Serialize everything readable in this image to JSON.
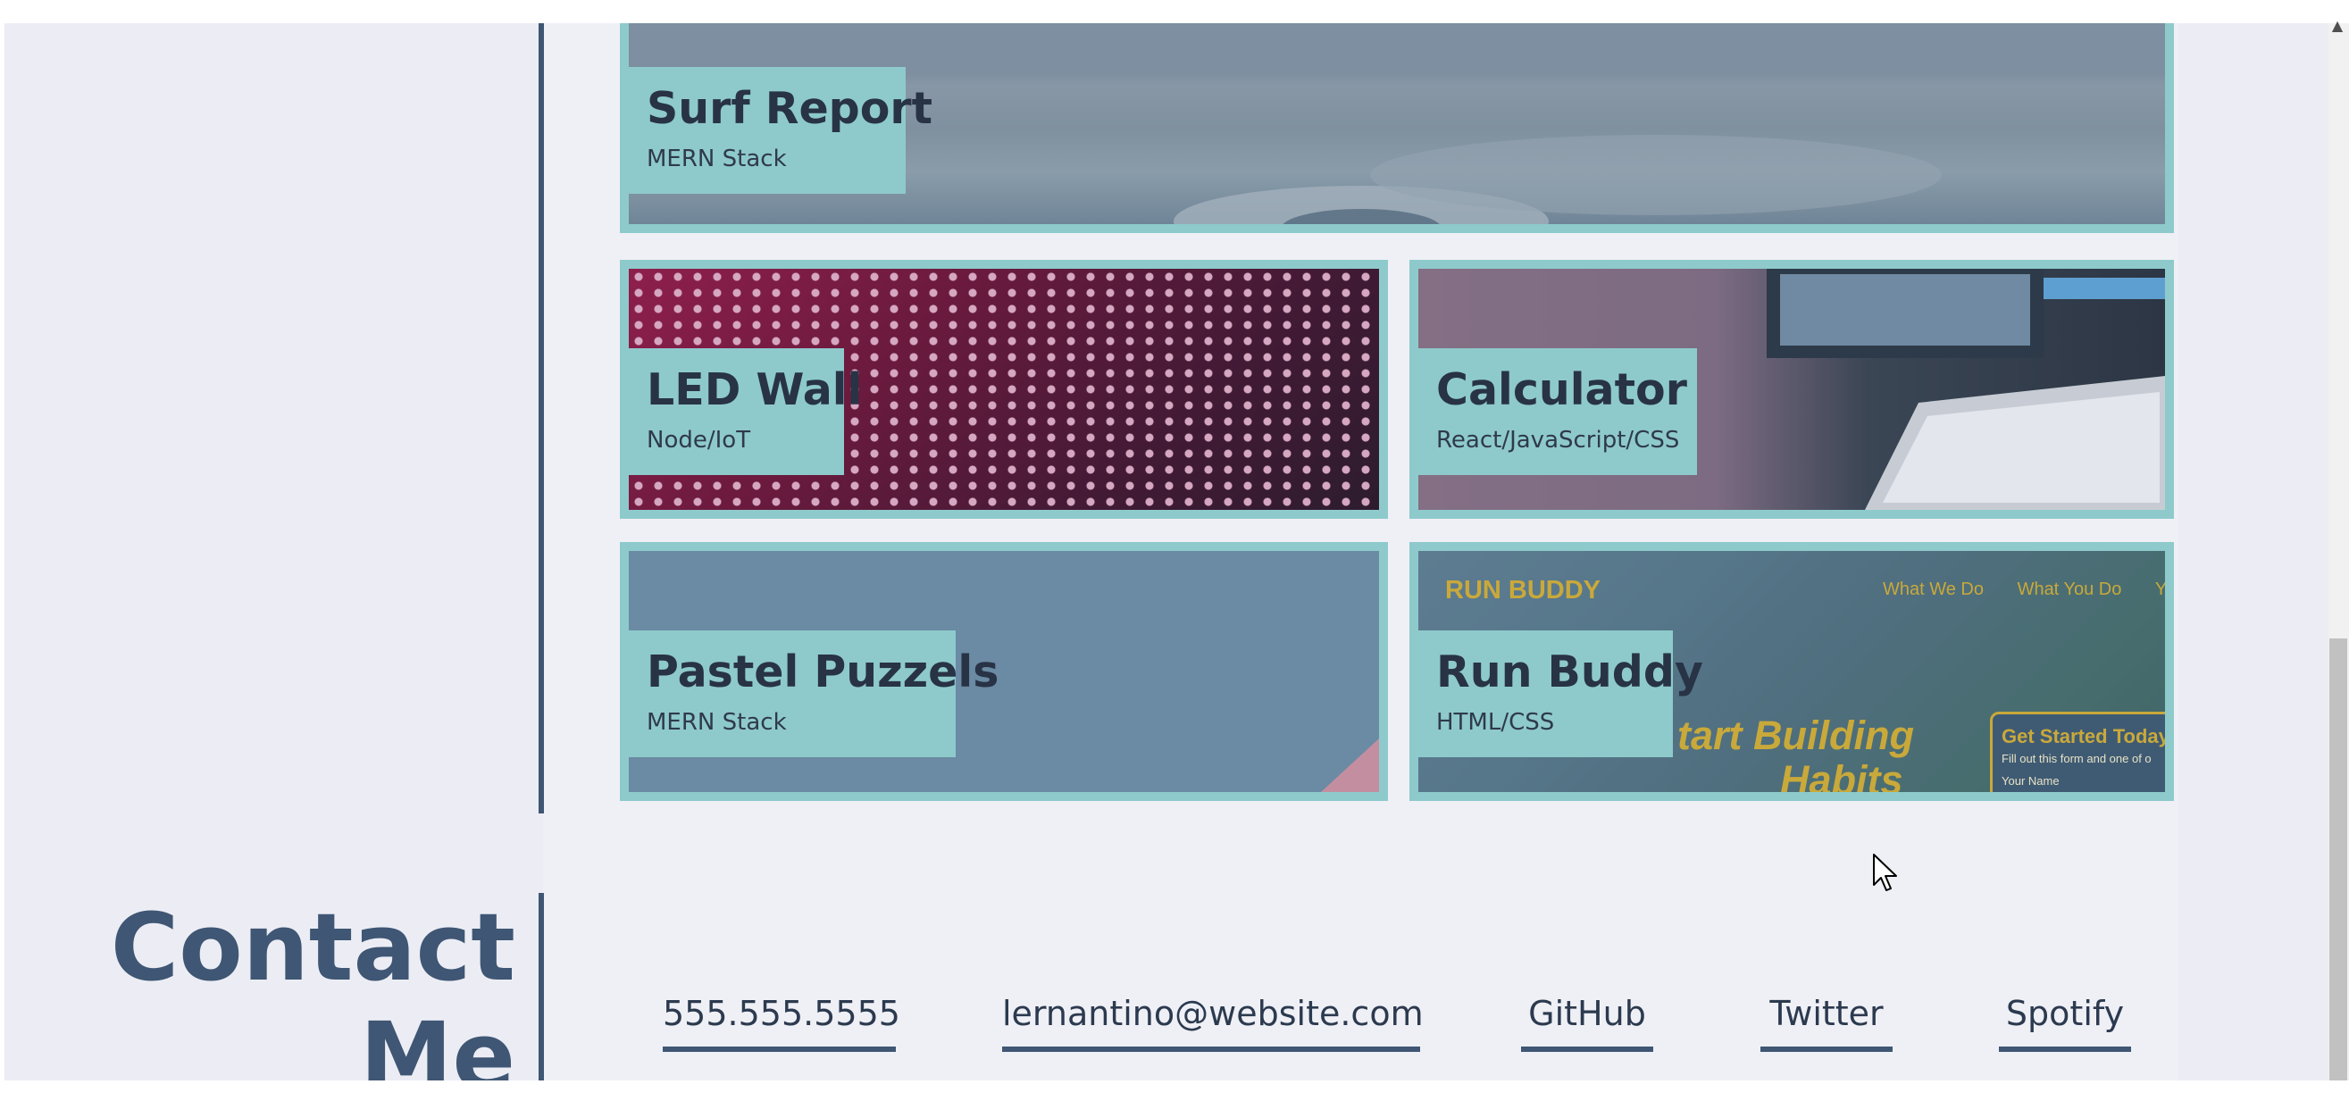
{
  "projects": {
    "surf": {
      "title": "Surf Report",
      "stack": "MERN Stack"
    },
    "led": {
      "title": "LED Wall",
      "stack": "Node/IoT"
    },
    "calculator": {
      "title": "Calculator",
      "stack": "React/JavaScript/CSS"
    },
    "puzzels": {
      "title": "Pastel Puzzels",
      "stack": "MERN Stack"
    },
    "runbuddy": {
      "title": "Run Buddy",
      "stack": "HTML/CSS",
      "preview_logo": "RUN BUDDY",
      "preview_nav": [
        "What We Do",
        "What You Do",
        "Yo"
      ],
      "preview_headline": [
        "tart Building",
        "Habits"
      ],
      "preview_form_title": "Get Started Today",
      "preview_form_text": "Fill out this form and one of o",
      "preview_form_field": "Your Name"
    }
  },
  "contact": {
    "heading_line1": "Contact",
    "heading_line2": "Me",
    "phone": "555.555.5555",
    "email": "lernantino@website.com",
    "links": [
      "GitHub",
      "Twitter",
      "Spotify"
    ]
  },
  "colors": {
    "accent": "#8ecacb",
    "heading": "#3f5674",
    "background": "#ecedf4"
  },
  "icons": {
    "cursor": "arrow-cursor-icon",
    "scroll_up": "scroll-up-arrow-icon"
  }
}
